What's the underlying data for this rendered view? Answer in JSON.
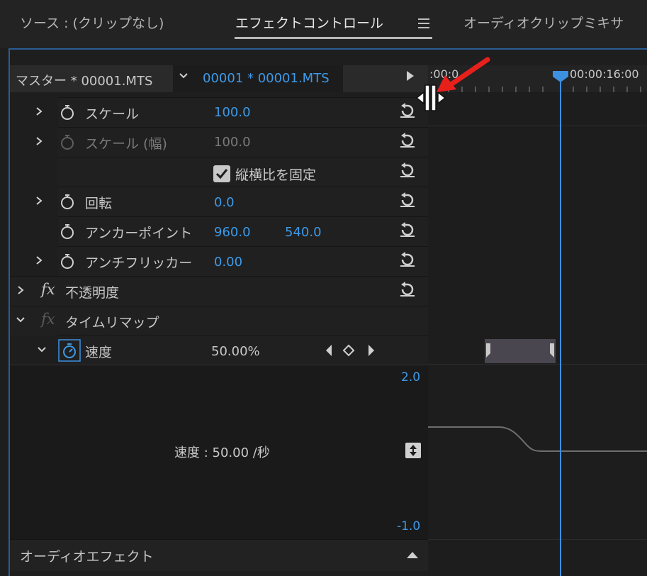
{
  "tabs": [
    {
      "label": "ソース : (クリップなし)",
      "active": false
    },
    {
      "label": "エフェクトコントロール",
      "active": true
    },
    {
      "label": "オーディオクリップミキサ",
      "active": false
    }
  ],
  "header": {
    "master_label": "マスター * 00001.MTS",
    "clip_label": "00001 * 00001.MTS"
  },
  "timeline": {
    "ruler_start": ":00:0",
    "ruler_time": "00:00:16:00"
  },
  "properties": {
    "scale": {
      "label": "スケール",
      "value": "100.0"
    },
    "scale_width": {
      "label": "スケール (幅)",
      "value": "100.0"
    },
    "uniform_scale": {
      "label": "縦横比を固定",
      "checked": true
    },
    "rotation": {
      "label": "回転",
      "value": "0.0"
    },
    "anchor_point": {
      "label": "アンカーポイント",
      "x": "960.0",
      "y": "540.0"
    },
    "anti_flicker": {
      "label": "アンチフリッカー",
      "value": "0.00"
    }
  },
  "effects": {
    "opacity": {
      "fx": "fx",
      "label": "不透明度"
    },
    "time_remap": {
      "fx": "fx",
      "label": "タイムリマップ"
    },
    "speed": {
      "label": "速度",
      "value": "50.00%"
    }
  },
  "graph": {
    "max": "2.0",
    "min": "-1.0",
    "label": "速度 : 50.00 /秒"
  },
  "audio_effects": {
    "label": "オーディオエフェクト"
  },
  "colors": {
    "accent": "#3d9ae8",
    "playhead": "#3d8fe0",
    "annotation": "#e8201c"
  }
}
